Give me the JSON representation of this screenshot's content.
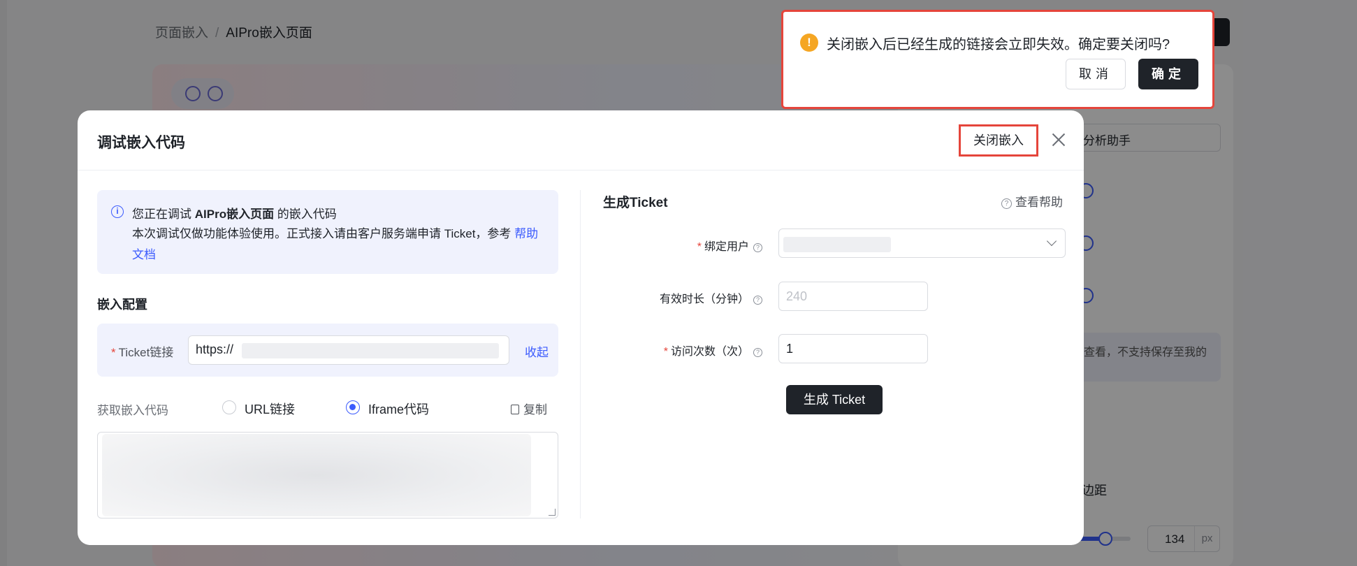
{
  "background": {
    "breadcrumb": [
      "页面嵌入",
      "AIPro嵌入页面"
    ],
    "select_text": "分析助手",
    "note_text": "查看，不支持保存至我的",
    "margin_label": "边距",
    "slider_value": "134",
    "slider_unit": "px"
  },
  "modal": {
    "title": "调试嵌入代码",
    "close_embed_label": "关闭嵌入",
    "info": {
      "prefix": "您正在调试 ",
      "page_name": "AIPro嵌入页面",
      "suffix": " 的嵌入代码",
      "line2": "本次调试仅做功能体验使用。正式接入请由客户服务端申请 Ticket，参考 ",
      "link": "帮助文档"
    },
    "embed_config_title": "嵌入配置",
    "ticket_label": "Ticket链接",
    "ticket_value": "https://",
    "collapse_label": "收起",
    "get_code_label": "获取嵌入代码",
    "radio_url": "URL链接",
    "radio_iframe": "Iframe代码",
    "copy_label": "复制",
    "generate": {
      "title": "生成Ticket",
      "help_label": "查看帮助",
      "bind_user_label": "绑定用户",
      "duration_label": "有效时长（分钟）",
      "duration_placeholder": "240",
      "visits_label": "访问次数（次）",
      "visits_value": "1",
      "button_label": "生成 Ticket"
    }
  },
  "popover": {
    "message": "关闭嵌入后已经生成的链接会立即失效。确定要关闭吗?",
    "cancel_label": "取消",
    "ok_label": "确定"
  },
  "colors": {
    "accent": "#3b5bfd",
    "danger": "#e5453b",
    "warning": "#f5a623",
    "dark_button": "#1f2329"
  }
}
